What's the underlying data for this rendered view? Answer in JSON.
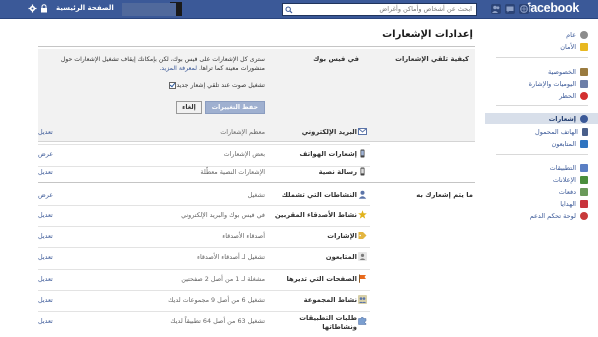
{
  "topbar": {
    "logo": "facebook",
    "search_placeholder": "ابحث عن أشخاص وأماكن وأغراض",
    "home_label": "الصفحة الرئيسية"
  },
  "sidebar": {
    "items": [
      {
        "label": "عام",
        "icon": "gear-icon"
      },
      {
        "label": "الأمان",
        "icon": "shield-icon"
      },
      {
        "label": "الخصوصية",
        "icon": "privacy-icon"
      },
      {
        "label": "اليوميات والإشارة",
        "icon": "timeline-icon"
      },
      {
        "label": "الحظر",
        "icon": "block-icon"
      },
      {
        "label": "إشعارات",
        "icon": "globe-icon"
      },
      {
        "label": "الهاتف المحمول",
        "icon": "mobile-icon"
      },
      {
        "label": "المتابعون",
        "icon": "rss-icon"
      },
      {
        "label": "التطبيقات",
        "icon": "apps-icon"
      },
      {
        "label": "الإعلانات",
        "icon": "ads-icon"
      },
      {
        "label": "دفعات",
        "icon": "payments-icon"
      },
      {
        "label": "الهدايا",
        "icon": "gift-icon"
      },
      {
        "label": "لوحة تحكم الدعم",
        "icon": "lifebuoy-icon"
      }
    ]
  },
  "main": {
    "title": "إعدادات الإشعارات",
    "how": {
      "heading": "كيفية تلقي الإشعارات",
      "sub": "في فيس بوك",
      "desc": "سترى كل الإشعارات على فيس بوك، لكن بإمكانك إيقاف تشغيل الإشعارات حول منشورات معينة كما تراها.",
      "learn_more": "لمعرفة المزيد.",
      "sound_label": "تشغيل صوت عند تلقي إشعار جديد",
      "save_label": "حفظ التغييرات",
      "cancel_label": "إلغاء"
    },
    "channels": [
      {
        "label": "البريد الإلكتروني",
        "value": "معظم الإشعارات",
        "action": "تعديل",
        "icon": "email-icon"
      },
      {
        "label": "إشعارات الهواتف",
        "value": "بعض الإشعارات",
        "action": "عرض",
        "icon": "phone-icon"
      },
      {
        "label": "رسالة نصية",
        "value": "الإشعارات النصية معطّلة",
        "action": "تعديل",
        "icon": "sms-icon"
      }
    ],
    "about_heading": "ما يتم إشعارك به",
    "topics": [
      {
        "label": "النشاطات التي تشملك",
        "value": "تشغيل",
        "action": "عرض",
        "icon": "person-icon"
      },
      {
        "label": "نشاط الأصدقاء المقربين",
        "value": "في فيس بوك والبريد الإلكتروني",
        "action": "تعديل",
        "icon": "star-icon"
      },
      {
        "label": "الإشارات",
        "value": "أصدقاء الأصدقاء",
        "action": "تعديل",
        "icon": "tag-icon"
      },
      {
        "label": "المتابعون",
        "value": "تشغيل لـ أصدقاء الأصدقاء",
        "action": "تعديل",
        "icon": "followers-icon"
      },
      {
        "label": "الصفحات التي تديرها",
        "value": "مشغلة لـ 1 من أصل 2 صفحتين",
        "action": "تعديل",
        "icon": "flag-icon"
      },
      {
        "label": "نشاط المجموعة",
        "value": "تشغيل 6 من أصل 9 مجموعات لديك",
        "action": "تعديل",
        "icon": "group-icon"
      },
      {
        "label": "طلبات التطبيقات ونشاطاتها",
        "value": "تشغيل 63 من أصل 64 تطبيقاً لديك",
        "action": "تعديل",
        "icon": "puzzle-icon"
      }
    ]
  },
  "colors": {
    "brand": "#3b5998",
    "active_sidebar": "#d8dfea",
    "section_bg": "#f2f2f2"
  }
}
